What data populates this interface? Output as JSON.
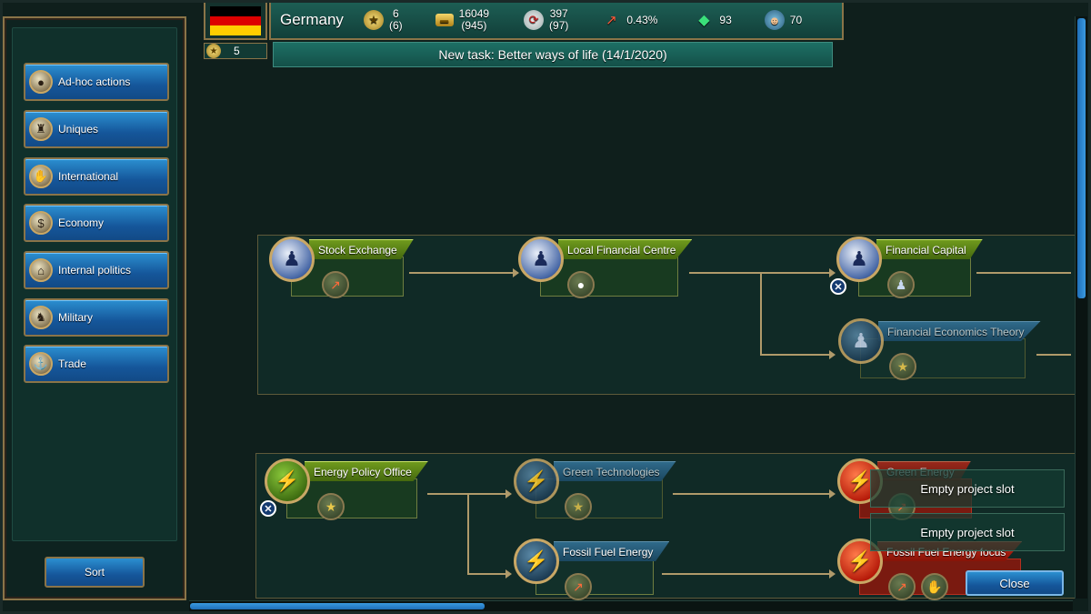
{
  "header": {
    "country": "Germany",
    "stats": {
      "rank": {
        "icon": "star-icon",
        "value": "6",
        "sub": "(6)"
      },
      "money": {
        "icon": "gold-bars-icon",
        "value": "16049",
        "sub": "(945)"
      },
      "cycle": {
        "icon": "recycle-icon",
        "value": "397",
        "sub": "(97)"
      },
      "growth": {
        "icon": "growth-chart-icon",
        "value": "0.43%"
      },
      "crystals": {
        "icon": "crystal-icon",
        "value": "93"
      },
      "population": {
        "icon": "worker-icon",
        "value": "70"
      }
    },
    "stars_count": "5",
    "task": "New task: Better ways of life  (14/1/2020)"
  },
  "sidebar": {
    "items": [
      {
        "label": "Ad-hoc actions",
        "icon": "bomb-icon"
      },
      {
        "label": "Uniques",
        "icon": "tower-icon"
      },
      {
        "label": "International",
        "icon": "handshake-icon"
      },
      {
        "label": "Economy",
        "icon": "coins-icon"
      },
      {
        "label": "Internal politics",
        "icon": "parliament-icon"
      },
      {
        "label": "Military",
        "icon": "soldier-icon"
      },
      {
        "label": "Trade",
        "icon": "trade-icon"
      }
    ],
    "sort_label": "Sort"
  },
  "tree": {
    "finance": [
      {
        "label": "Stock Exchange",
        "state": "active"
      },
      {
        "label": "Local Financial Centre",
        "state": "active"
      },
      {
        "label": "Financial Capital",
        "state": "active"
      },
      {
        "label": "Financial Economics Theory",
        "state": "locked"
      }
    ],
    "energy": [
      {
        "label": "Energy Policy Office",
        "state": "active"
      },
      {
        "label": "Green Technologies",
        "state": "locked"
      },
      {
        "label": "Green Energy",
        "state": "selected"
      },
      {
        "label": "Fossil Fuel Energy",
        "state": "available"
      },
      {
        "label": "Fossil Fuel Energy focus",
        "state": "selected"
      }
    ]
  },
  "overlay": {
    "slot1": "Empty project slot",
    "slot2": "Empty project slot",
    "close_label": "Close"
  },
  "colors": {
    "accent_gold": "#8a7448",
    "button_blue": "#15569a",
    "active_green": "#45680f",
    "selected_red": "#b41808"
  }
}
